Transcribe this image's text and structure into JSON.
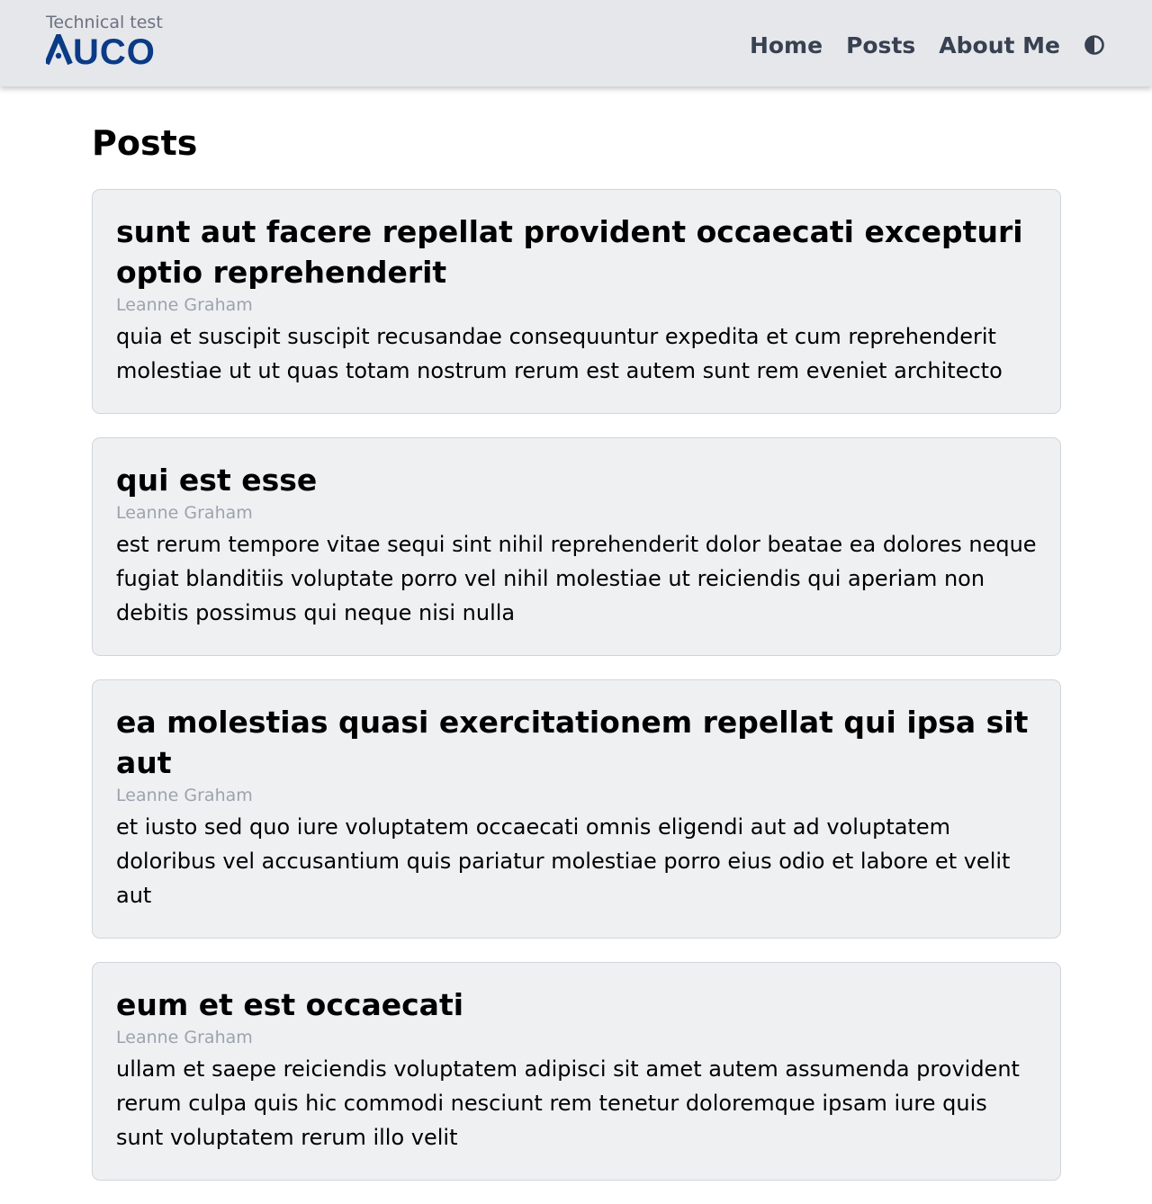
{
  "brand": {
    "tagline": "Technical test",
    "logo_text": "AUCO",
    "logo_color": "#0b3a86"
  },
  "nav": {
    "links": [
      {
        "label": "Home"
      },
      {
        "label": "Posts"
      },
      {
        "label": "About Me"
      }
    ],
    "theme_toggle_icon": "half-circle-contrast-icon"
  },
  "page": {
    "title": "Posts"
  },
  "posts": [
    {
      "title": "sunt aut facere repellat provident occaecati excepturi optio reprehenderit",
      "author": "Leanne Graham",
      "body": "quia et suscipit suscipit recusandae consequuntur expedita et cum reprehenderit molestiae ut ut quas totam nostrum rerum est autem sunt rem eveniet architecto"
    },
    {
      "title": "qui est esse",
      "author": "Leanne Graham",
      "body": "est rerum tempore vitae sequi sint nihil reprehenderit dolor beatae ea dolores neque fugiat blanditiis voluptate porro vel nihil molestiae ut reiciendis qui aperiam non debitis possimus qui neque nisi nulla"
    },
    {
      "title": "ea molestias quasi exercitationem repellat qui ipsa sit aut",
      "author": "Leanne Graham",
      "body": "et iusto sed quo iure voluptatem occaecati omnis eligendi aut ad voluptatem doloribus vel accusantium quis pariatur molestiae porro eius odio et labore et velit aut"
    },
    {
      "title": "eum et est occaecati",
      "author": "Leanne Graham",
      "body": "ullam et saepe reiciendis voluptatem adipisci sit amet autem assumenda provident rerum culpa quis hic commodi nesciunt rem tenetur doloremque ipsam iure quis sunt voluptatem rerum illo velit"
    }
  ]
}
